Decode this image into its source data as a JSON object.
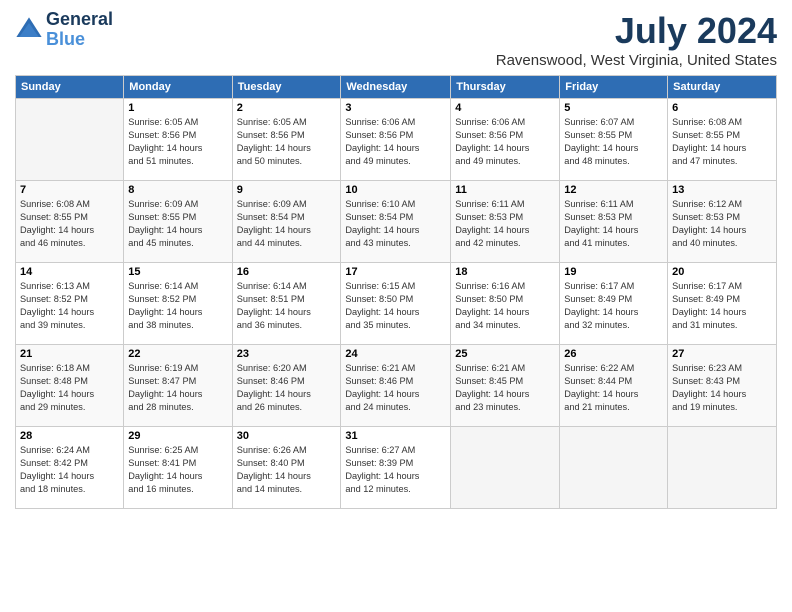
{
  "logo": {
    "line1": "General",
    "line2": "Blue"
  },
  "title": "July 2024",
  "location": "Ravenswood, West Virginia, United States",
  "days_of_week": [
    "Sunday",
    "Monday",
    "Tuesday",
    "Wednesday",
    "Thursday",
    "Friday",
    "Saturday"
  ],
  "weeks": [
    [
      {
        "day": "",
        "sunrise": "",
        "sunset": "",
        "daylight": ""
      },
      {
        "day": "1",
        "sunrise": "Sunrise: 6:05 AM",
        "sunset": "Sunset: 8:56 PM",
        "daylight": "Daylight: 14 hours and 51 minutes."
      },
      {
        "day": "2",
        "sunrise": "Sunrise: 6:05 AM",
        "sunset": "Sunset: 8:56 PM",
        "daylight": "Daylight: 14 hours and 50 minutes."
      },
      {
        "day": "3",
        "sunrise": "Sunrise: 6:06 AM",
        "sunset": "Sunset: 8:56 PM",
        "daylight": "Daylight: 14 hours and 49 minutes."
      },
      {
        "day": "4",
        "sunrise": "Sunrise: 6:06 AM",
        "sunset": "Sunset: 8:56 PM",
        "daylight": "Daylight: 14 hours and 49 minutes."
      },
      {
        "day": "5",
        "sunrise": "Sunrise: 6:07 AM",
        "sunset": "Sunset: 8:55 PM",
        "daylight": "Daylight: 14 hours and 48 minutes."
      },
      {
        "day": "6",
        "sunrise": "Sunrise: 6:08 AM",
        "sunset": "Sunset: 8:55 PM",
        "daylight": "Daylight: 14 hours and 47 minutes."
      }
    ],
    [
      {
        "day": "7",
        "sunrise": "Sunrise: 6:08 AM",
        "sunset": "Sunset: 8:55 PM",
        "daylight": "Daylight: 14 hours and 46 minutes."
      },
      {
        "day": "8",
        "sunrise": "Sunrise: 6:09 AM",
        "sunset": "Sunset: 8:55 PM",
        "daylight": "Daylight: 14 hours and 45 minutes."
      },
      {
        "day": "9",
        "sunrise": "Sunrise: 6:09 AM",
        "sunset": "Sunset: 8:54 PM",
        "daylight": "Daylight: 14 hours and 44 minutes."
      },
      {
        "day": "10",
        "sunrise": "Sunrise: 6:10 AM",
        "sunset": "Sunset: 8:54 PM",
        "daylight": "Daylight: 14 hours and 43 minutes."
      },
      {
        "day": "11",
        "sunrise": "Sunrise: 6:11 AM",
        "sunset": "Sunset: 8:53 PM",
        "daylight": "Daylight: 14 hours and 42 minutes."
      },
      {
        "day": "12",
        "sunrise": "Sunrise: 6:11 AM",
        "sunset": "Sunset: 8:53 PM",
        "daylight": "Daylight: 14 hours and 41 minutes."
      },
      {
        "day": "13",
        "sunrise": "Sunrise: 6:12 AM",
        "sunset": "Sunset: 8:53 PM",
        "daylight": "Daylight: 14 hours and 40 minutes."
      }
    ],
    [
      {
        "day": "14",
        "sunrise": "Sunrise: 6:13 AM",
        "sunset": "Sunset: 8:52 PM",
        "daylight": "Daylight: 14 hours and 39 minutes."
      },
      {
        "day": "15",
        "sunrise": "Sunrise: 6:14 AM",
        "sunset": "Sunset: 8:52 PM",
        "daylight": "Daylight: 14 hours and 38 minutes."
      },
      {
        "day": "16",
        "sunrise": "Sunrise: 6:14 AM",
        "sunset": "Sunset: 8:51 PM",
        "daylight": "Daylight: 14 hours and 36 minutes."
      },
      {
        "day": "17",
        "sunrise": "Sunrise: 6:15 AM",
        "sunset": "Sunset: 8:50 PM",
        "daylight": "Daylight: 14 hours and 35 minutes."
      },
      {
        "day": "18",
        "sunrise": "Sunrise: 6:16 AM",
        "sunset": "Sunset: 8:50 PM",
        "daylight": "Daylight: 14 hours and 34 minutes."
      },
      {
        "day": "19",
        "sunrise": "Sunrise: 6:17 AM",
        "sunset": "Sunset: 8:49 PM",
        "daylight": "Daylight: 14 hours and 32 minutes."
      },
      {
        "day": "20",
        "sunrise": "Sunrise: 6:17 AM",
        "sunset": "Sunset: 8:49 PM",
        "daylight": "Daylight: 14 hours and 31 minutes."
      }
    ],
    [
      {
        "day": "21",
        "sunrise": "Sunrise: 6:18 AM",
        "sunset": "Sunset: 8:48 PM",
        "daylight": "Daylight: 14 hours and 29 minutes."
      },
      {
        "day": "22",
        "sunrise": "Sunrise: 6:19 AM",
        "sunset": "Sunset: 8:47 PM",
        "daylight": "Daylight: 14 hours and 28 minutes."
      },
      {
        "day": "23",
        "sunrise": "Sunrise: 6:20 AM",
        "sunset": "Sunset: 8:46 PM",
        "daylight": "Daylight: 14 hours and 26 minutes."
      },
      {
        "day": "24",
        "sunrise": "Sunrise: 6:21 AM",
        "sunset": "Sunset: 8:46 PM",
        "daylight": "Daylight: 14 hours and 24 minutes."
      },
      {
        "day": "25",
        "sunrise": "Sunrise: 6:21 AM",
        "sunset": "Sunset: 8:45 PM",
        "daylight": "Daylight: 14 hours and 23 minutes."
      },
      {
        "day": "26",
        "sunrise": "Sunrise: 6:22 AM",
        "sunset": "Sunset: 8:44 PM",
        "daylight": "Daylight: 14 hours and 21 minutes."
      },
      {
        "day": "27",
        "sunrise": "Sunrise: 6:23 AM",
        "sunset": "Sunset: 8:43 PM",
        "daylight": "Daylight: 14 hours and 19 minutes."
      }
    ],
    [
      {
        "day": "28",
        "sunrise": "Sunrise: 6:24 AM",
        "sunset": "Sunset: 8:42 PM",
        "daylight": "Daylight: 14 hours and 18 minutes."
      },
      {
        "day": "29",
        "sunrise": "Sunrise: 6:25 AM",
        "sunset": "Sunset: 8:41 PM",
        "daylight": "Daylight: 14 hours and 16 minutes."
      },
      {
        "day": "30",
        "sunrise": "Sunrise: 6:26 AM",
        "sunset": "Sunset: 8:40 PM",
        "daylight": "Daylight: 14 hours and 14 minutes."
      },
      {
        "day": "31",
        "sunrise": "Sunrise: 6:27 AM",
        "sunset": "Sunset: 8:39 PM",
        "daylight": "Daylight: 14 hours and 12 minutes."
      },
      {
        "day": "",
        "sunrise": "",
        "sunset": "",
        "daylight": ""
      },
      {
        "day": "",
        "sunrise": "",
        "sunset": "",
        "daylight": ""
      },
      {
        "day": "",
        "sunrise": "",
        "sunset": "",
        "daylight": ""
      }
    ]
  ]
}
